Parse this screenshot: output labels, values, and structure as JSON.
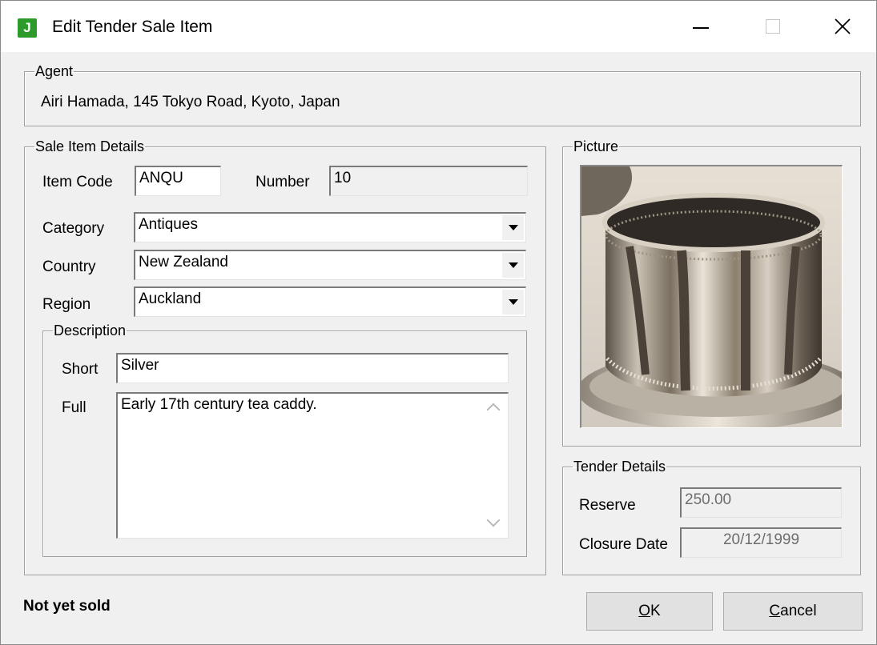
{
  "window": {
    "title": "Edit Tender Sale Item",
    "icon_letter": "J",
    "icon_color": "#2c9b2c",
    "controls": {
      "minimize": "minimize-icon",
      "maximize": "maximize-icon",
      "close": "close-icon"
    }
  },
  "agent": {
    "legend": "Agent",
    "value": "Airi Hamada, 145 Tokyo Road, Kyoto, Japan"
  },
  "sale_item": {
    "legend": "Sale Item Details",
    "item_code_label": "Item Code",
    "item_code": "ANQU",
    "number_label": "Number",
    "number": "10",
    "category_label": "Category",
    "category": "Antiques",
    "country_label": "Country",
    "country": "New Zealand",
    "region_label": "Region",
    "region": "Auckland",
    "description": {
      "legend": "Description",
      "short_label": "Short",
      "short": "Silver",
      "full_label": "Full",
      "full": "Early 17th century tea caddy."
    }
  },
  "picture": {
    "legend": "Picture"
  },
  "tender": {
    "legend": "Tender Details",
    "reserve_label": "Reserve",
    "reserve": "250.00",
    "closure_label": "Closure Date",
    "closure": "20/12/1999"
  },
  "status_text": "Not yet sold",
  "buttons": {
    "ok_accel": "O",
    "ok_rest": "K",
    "cancel_accel": "C",
    "cancel_rest": "ancel"
  }
}
